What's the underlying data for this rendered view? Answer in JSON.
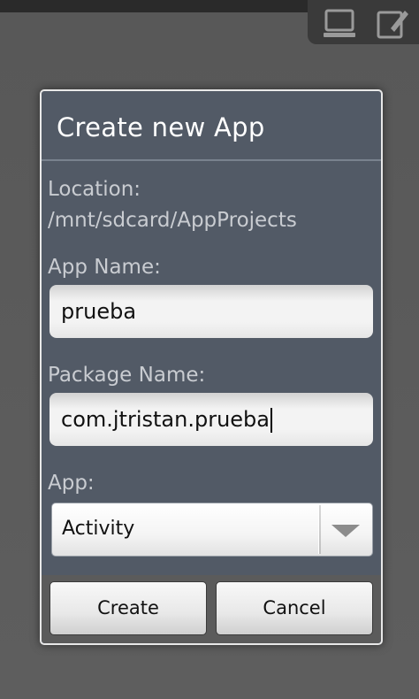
{
  "dialog": {
    "title": "Create new App",
    "location_label": "Location:",
    "location_path": "/mnt/sdcard/AppProjects",
    "app_name": {
      "label": "App Name:",
      "value": "prueba"
    },
    "package_name": {
      "label": "Package Name:",
      "value": "com.jtristan.prueba"
    },
    "app_type": {
      "label": "App:",
      "selected": "Activity"
    },
    "buttons": {
      "create": "Create",
      "cancel": "Cancel"
    }
  },
  "background_toolbar": {
    "icons": [
      "monitor-icon",
      "edit-icon"
    ]
  },
  "colors": {
    "dialog_bg": "#525a66",
    "label_text": "#c9ccd1",
    "title_text": "#ffffff",
    "button_bar": "#5b5b5b"
  }
}
